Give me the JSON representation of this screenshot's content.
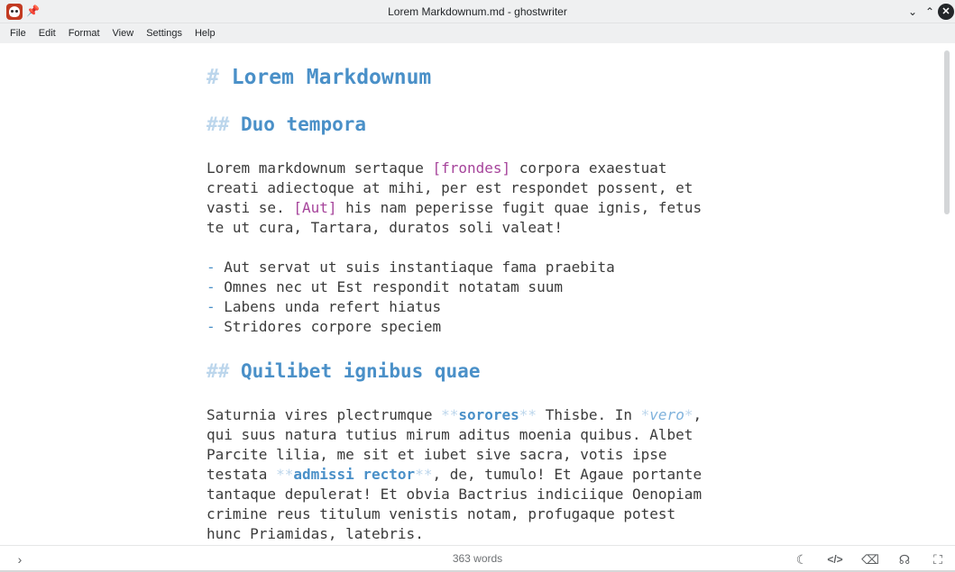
{
  "window": {
    "title": "Lorem Markdownum.md - ghostwriter",
    "pin_icon": "pin-icon",
    "app_icon": "ghostwriter-icon"
  },
  "menu": {
    "items": [
      "File",
      "Edit",
      "Format",
      "View",
      "Settings",
      "Help"
    ]
  },
  "document": {
    "h1": {
      "marker": "#",
      "text": "Lorem Markdownum"
    },
    "h2_a": {
      "marker": "##",
      "text": "Duo tempora"
    },
    "para1": {
      "l1_a": "Lorem markdownum sertaque ",
      "l1_link": "[frondes]",
      "l1_b": " corpora exaestuat",
      "l2": "creati adiectoque at mihi, per est respondet possent, et",
      "l3_a": "vasti se. ",
      "l3_link": "[Aut]",
      "l3_b": " his nam peperisse fugit quae ignis, fetus",
      "l4": "te ut cura, Tartara, duratos soli valeat!"
    },
    "list": {
      "marker": "-",
      "items": [
        "Aut servat ut suis instantiaque fama praebita",
        "Omnes nec ut Est respondit notatam suum",
        "Labens unda refert hiatus",
        "Stridores corpore speciem"
      ]
    },
    "h2_b": {
      "marker": "##",
      "text": "Quilibet ignibus quae"
    },
    "para2": {
      "strong_marker": "**",
      "em_marker": "*",
      "l1_a": "Saturnia vires plectrumque ",
      "l1_strong": "sorores",
      "l1_b": " Thisbe. In ",
      "l1_em": "vero",
      "l1_c": ",",
      "l2": "qui suus natura tutius mirum aditus moenia quibus. Albet",
      "l3": "Parcite lilia, me sit et iubet sive sacra, votis ipse",
      "l4_a": "testata ",
      "l4_strong": "admissi rector",
      "l4_b": ", de, tumulo! Et Agaue portante",
      "l5": "tantaque depulerat! Et obvia Bactrius indiciique Oenopiam",
      "l6": "crimine reus titulum venistis notam, profugaque potest",
      "l7": "hunc Priamidas, latebris."
    }
  },
  "status": {
    "word_count": "363 words",
    "icons": [
      "sidebar-toggle-icon",
      "moon-icon",
      "code-icon",
      "backspace-icon",
      "headphones-icon",
      "fullscreen-icon"
    ]
  },
  "colors": {
    "heading": "#4a90c8",
    "markup": "#bcd6ec",
    "link": "#a6449b",
    "text": "#3b3b3b"
  }
}
